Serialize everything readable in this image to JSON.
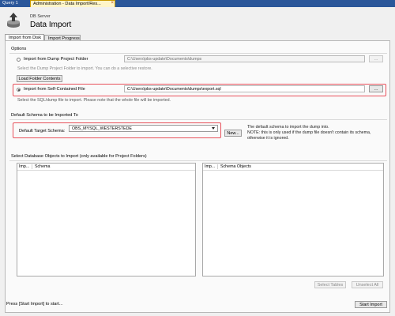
{
  "tabs": [
    {
      "label": "Query 1"
    },
    {
      "label": "Administration - Data Import/Res..."
    }
  ],
  "icons": {
    "tab_close": "close-icon",
    "header": "server-upload-icon",
    "radio": "radio-button-icon",
    "caret": "chevron-down-icon"
  },
  "header": {
    "subtitle": "DB Server",
    "title": "Data Import"
  },
  "subtabs": [
    "Import from Disk",
    "Import Progress"
  ],
  "options": {
    "title": "Options",
    "dump_folder": {
      "label": "Import from Dump Project Folder",
      "path": "C:\\Users\\pbs-update\\Documents\\dumps",
      "browse": "...",
      "hint": "Select the Dump Project Folder to import. You can do a selective restore.",
      "load_button": "Load Folder Contents"
    },
    "self_contained": {
      "label": "Import from Self-Contained File",
      "path": "C:\\Users\\pbs-update\\Documents\\dumps\\export.sql",
      "browse": "...",
      "hint": "Select the SQL/dump file to import. Please note that the whole file will be imported."
    }
  },
  "default_schema": {
    "title": "Default Schema to be Imported To",
    "label": "Default Target Schema:",
    "value": "OBS_MYSQL_WESTERSTEDE",
    "new_button": "New...",
    "note_line1": "The default schema to import the dump into.",
    "note_line2": "NOTE: this is only used if the dump file doesn't contain its schema,",
    "note_line3": "otherwise it is ignored."
  },
  "objects": {
    "title": "Select Database Objects to Import (only available for Project Folders)",
    "schemas_cols": [
      "Imp...",
      "Schema"
    ],
    "objects_cols": [
      "Imp...",
      "Schema Objects"
    ],
    "select_tables": "Select Tables",
    "unselect_all": "Unselect All"
  },
  "footer": {
    "status": "Press [Start Import] to start...",
    "start_button": "Start Import"
  },
  "colors": {
    "tab_bar": "#2b579a",
    "active_tab": "#fff5c8",
    "highlight": "#e8505a"
  }
}
